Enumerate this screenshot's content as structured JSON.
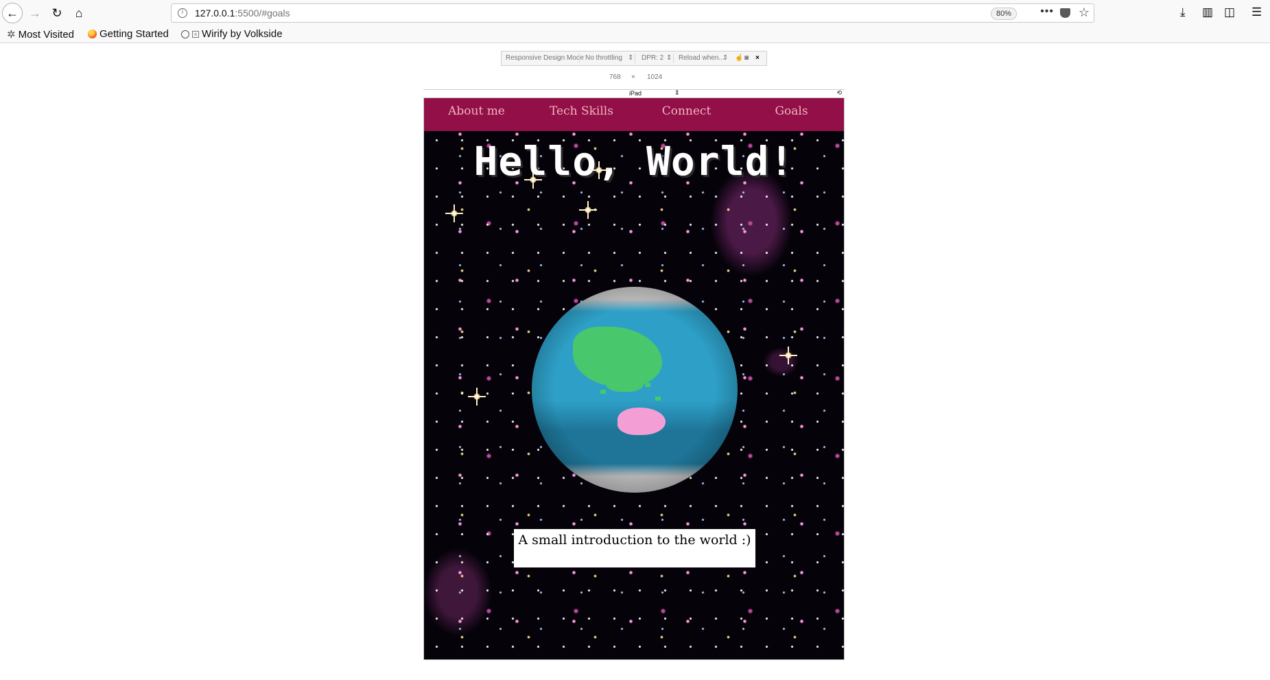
{
  "browser": {
    "url_host": "127.0.0.1",
    "url_path": ":5500/#goals",
    "zoom": "80%",
    "bookmarks": [
      {
        "label": "Most Visited"
      },
      {
        "label": "Getting Started"
      },
      {
        "label": "Wirify by Volkside"
      }
    ]
  },
  "rdm": {
    "mode_label": "Responsive Design Mode",
    "throttling": "No throttling",
    "dpr": "DPR: 2",
    "reload": "Reload when...",
    "width": "768",
    "times": "×",
    "height": "1024",
    "device": "iPad"
  },
  "page": {
    "nav": [
      "About me",
      "Tech Skills",
      "Connect",
      "Goals"
    ],
    "heading": "Hello, World!",
    "caption": "A small introduction to the world :)"
  },
  "colors": {
    "nav_bg": "#920f48",
    "nav_text": "#f2b5bd",
    "land": "#49c76c",
    "australia": "#f39fd6",
    "ocean": "#2ea0c8"
  }
}
